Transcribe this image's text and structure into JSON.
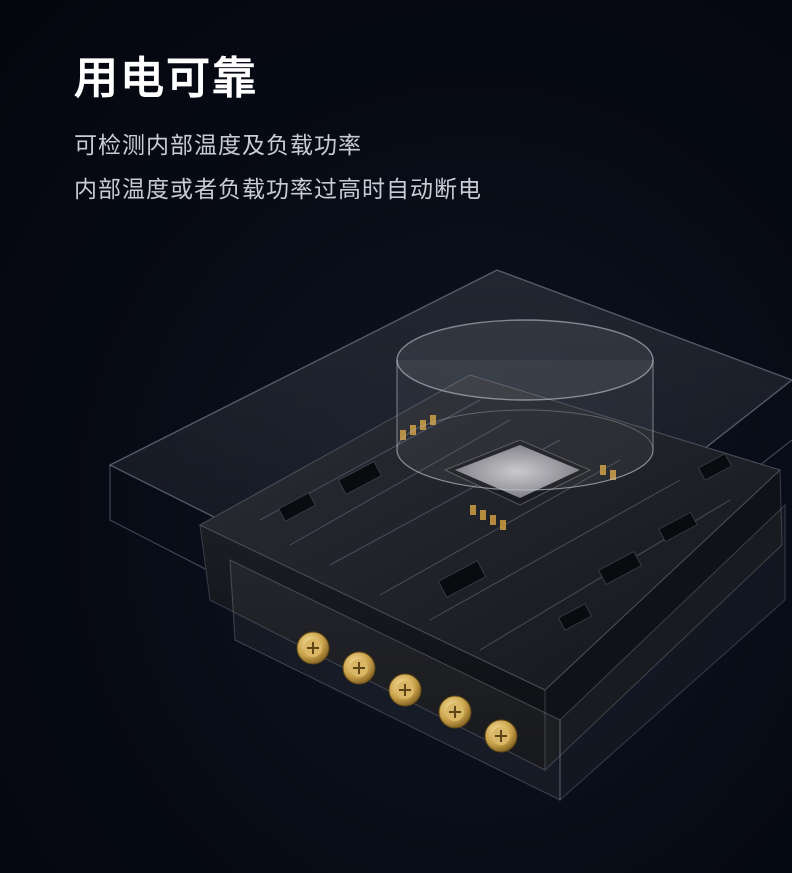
{
  "headline": "用电可靠",
  "description": {
    "line1": "可检测内部温度及负载功率",
    "line2": "内部温度或者负载功率过高时自动断电"
  },
  "illustration": {
    "subject": "circuit-board-module-icon"
  },
  "colors": {
    "background": "#070b16",
    "headline": "#ffffff",
    "body_text": "#c9ccd4",
    "terminal_gold": "#c9a24a"
  }
}
